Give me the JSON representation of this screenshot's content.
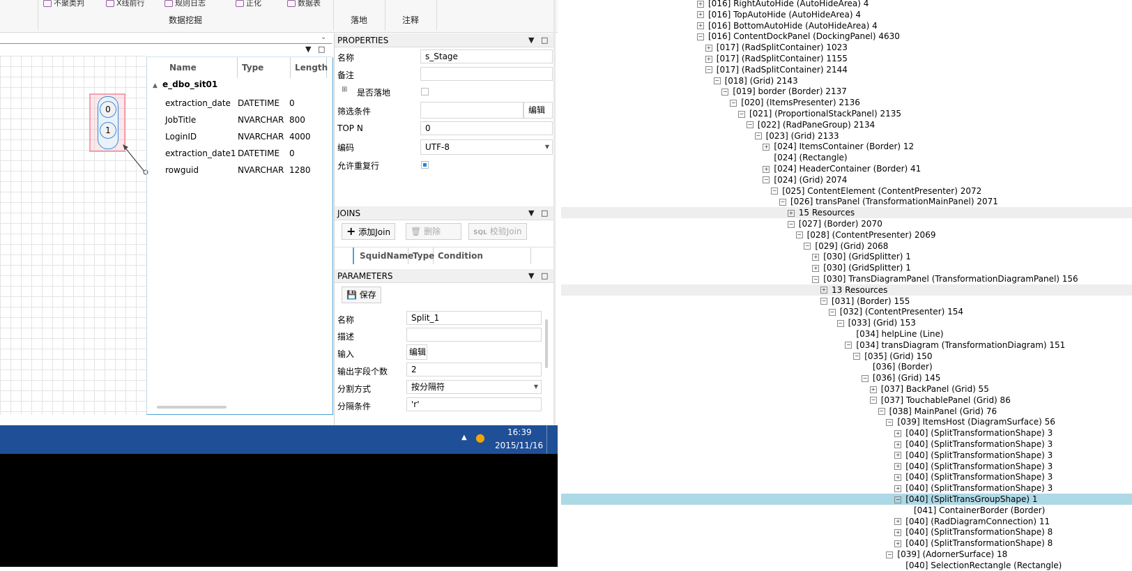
{
  "ribbon": {
    "group_labels": [
      "数据挖掘",
      "落地",
      "注释"
    ],
    "cut_items": [
      "不聚类判",
      "X线前行",
      "规则日志",
      "正化",
      "数据表"
    ]
  },
  "canvas": {
    "ports": [
      "0",
      "1"
    ]
  },
  "table": {
    "headers": [
      "Name",
      "Type",
      "Length"
    ],
    "group_name": "e_dbo_sit01",
    "rows": [
      {
        "name": "extraction_date",
        "type": "DATETIME",
        "length": "0"
      },
      {
        "name": "JobTitle",
        "type": "NVARCHAR",
        "length": "800"
      },
      {
        "name": "LoginID",
        "type": "NVARCHAR",
        "length": "4000"
      },
      {
        "name": "extraction_date1",
        "type": "DATETIME",
        "length": "0"
      },
      {
        "name": "rowguid",
        "type": "NVARCHAR",
        "length": "1280"
      }
    ]
  },
  "properties": {
    "title": "PROPERTIES",
    "name_label": "名称",
    "name_value": "s_Stage",
    "remark_label": "备注",
    "remark_value": "",
    "landing_label": "是否落地",
    "filter_label": "筛选条件",
    "filter_button": "编辑",
    "topn_label": "TOP N",
    "topn_value": "0",
    "encoding_label": "编码",
    "encoding_value": "UTF-8",
    "allow_dup_label": "允许重复行"
  },
  "joins": {
    "title": "JOINS",
    "add_button": "添加Join",
    "delete_button": "删除",
    "validate_button": "校验Join",
    "validate_prefix": "SQL",
    "columns": [
      "SquidName",
      "Type",
      "Condition"
    ]
  },
  "parameters": {
    "title": "PARAMETERS",
    "save_button": "保存",
    "name_label": "名称",
    "name_value": "Split_1",
    "desc_label": "描述",
    "desc_value": "",
    "input_label": "输入",
    "input_button": "编辑",
    "outcount_label": "输出字段个数",
    "outcount_value": "2",
    "split_mode_label": "分割方式",
    "split_mode_value": "按分隔符",
    "separator_label": "分隔条件",
    "separator_value": "'r'"
  },
  "taskbar": {
    "time": "16:39",
    "date": "2015/11/16"
  },
  "tree": {
    "nodes": [
      {
        "text": "[016] RightAutoHide (AutoHideArea) 4",
        "indent": 0,
        "exp": "+"
      },
      {
        "text": "[016] TopAutoHide (AutoHideArea) 4",
        "indent": 0,
        "exp": "+"
      },
      {
        "text": "[016] BottomAutoHide (AutoHideArea) 4",
        "indent": 0,
        "exp": "+"
      },
      {
        "text": "[016] ContentDockPanel (DockingPanel) 4630",
        "indent": 0,
        "exp": "-"
      },
      {
        "text": "[017]  (RadSplitContainer) 1023",
        "indent": 1,
        "exp": "+"
      },
      {
        "text": "[017]  (RadSplitContainer) 1155",
        "indent": 1,
        "exp": "+"
      },
      {
        "text": "[017]  (RadSplitContainer) 2144",
        "indent": 1,
        "exp": "-"
      },
      {
        "text": "[018]  (Grid) 2143",
        "indent": 2,
        "exp": "-"
      },
      {
        "text": "[019] border (Border) 2137",
        "indent": 3,
        "exp": "-"
      },
      {
        "text": "[020]  (ItemsPresenter) 2136",
        "indent": 4,
        "exp": "-"
      },
      {
        "text": "[021]  (ProportionalStackPanel) 2135",
        "indent": 5,
        "exp": "-"
      },
      {
        "text": "[022]  (RadPaneGroup) 2134",
        "indent": 6,
        "exp": "-"
      },
      {
        "text": "[023]  (Grid) 2133",
        "indent": 7,
        "exp": "-"
      },
      {
        "text": "[024] ItemsContainer (Border) 12",
        "indent": 8,
        "exp": "+"
      },
      {
        "text": "[024]  (Rectangle)",
        "indent": 8,
        "exp": ""
      },
      {
        "text": "[024] HeaderContainer (Border) 41",
        "indent": 8,
        "exp": "+"
      },
      {
        "text": "[024]  (Grid) 2074",
        "indent": 8,
        "exp": "-"
      },
      {
        "text": "[025] ContentElement (ContentPresenter) 2072",
        "indent": 9,
        "exp": "-"
      },
      {
        "text": "[026] transPanel (TransformationMainPanel) 2071",
        "indent": 10,
        "exp": "-"
      },
      {
        "text": "15 Resources",
        "indent": 11,
        "exp": "+",
        "band": "grey"
      },
      {
        "text": "[027]  (Border) 2070",
        "indent": 11,
        "exp": "-"
      },
      {
        "text": "[028]  (ContentPresenter) 2069",
        "indent": 12,
        "exp": "-"
      },
      {
        "text": "[029]  (Grid) 2068",
        "indent": 13,
        "exp": "-"
      },
      {
        "text": "[030]  (GridSplitter) 1",
        "indent": 14,
        "exp": "+"
      },
      {
        "text": "[030]  (GridSplitter) 1",
        "indent": 14,
        "exp": "+"
      },
      {
        "text": "[030] TransDiagramPanel (TransformationDiagramPanel) 156",
        "indent": 14,
        "exp": "-"
      },
      {
        "text": "13 Resources",
        "indent": 15,
        "exp": "+",
        "band": "grey"
      },
      {
        "text": "[031]  (Border) 155",
        "indent": 15,
        "exp": "-"
      },
      {
        "text": "[032]  (ContentPresenter) 154",
        "indent": 16,
        "exp": "-"
      },
      {
        "text": "[033]  (Grid) 153",
        "indent": 17,
        "exp": "-"
      },
      {
        "text": "[034] helpLine (Line)",
        "indent": 18,
        "exp": ""
      },
      {
        "text": "[034] transDiagram (TransformationDiagram) 151",
        "indent": 18,
        "exp": "-"
      },
      {
        "text": "[035]  (Grid) 150",
        "indent": 19,
        "exp": "-"
      },
      {
        "text": "[036]  (Border)",
        "indent": 20,
        "exp": ""
      },
      {
        "text": "[036]  (Grid) 145",
        "indent": 20,
        "exp": "-"
      },
      {
        "text": "[037] BackPanel (Grid) 55",
        "indent": 21,
        "exp": "+"
      },
      {
        "text": "[037] TouchablePanel (Grid) 86",
        "indent": 21,
        "exp": "-"
      },
      {
        "text": "[038] MainPanel (Grid) 76",
        "indent": 22,
        "exp": "-"
      },
      {
        "text": "[039] ItemsHost (DiagramSurface) 56",
        "indent": 23,
        "exp": "-"
      },
      {
        "text": "[040]  (SplitTransformationShape) 3",
        "indent": 24,
        "exp": "+"
      },
      {
        "text": "[040]  (SplitTransformationShape) 3",
        "indent": 24,
        "exp": "+"
      },
      {
        "text": "[040]  (SplitTransformationShape) 3",
        "indent": 24,
        "exp": "+"
      },
      {
        "text": "[040]  (SplitTransformationShape) 3",
        "indent": 24,
        "exp": "+"
      },
      {
        "text": "[040]  (SplitTransformationShape) 3",
        "indent": 24,
        "exp": "+"
      },
      {
        "text": "[040]  (SplitTransformationShape) 3",
        "indent": 24,
        "exp": "+"
      },
      {
        "text": "[040]  (SplitTransGroupShape) 1",
        "indent": 24,
        "exp": "-",
        "band": "blue"
      },
      {
        "text": "[041] ContainerBorder (Border)",
        "indent": 25,
        "exp": ""
      },
      {
        "text": "[040]  (RadDiagramConnection) 11",
        "indent": 24,
        "exp": "+"
      },
      {
        "text": "[040]  (SplitTransformationShape) 8",
        "indent": 24,
        "exp": "+"
      },
      {
        "text": "[040]  (SplitTransformationShape) 8",
        "indent": 24,
        "exp": "+"
      },
      {
        "text": "[039]  (AdornerSurface) 18",
        "indent": 23,
        "exp": "-"
      },
      {
        "text": "[040] SelectionRectangle (Rectangle)",
        "indent": 24,
        "exp": ""
      }
    ]
  }
}
